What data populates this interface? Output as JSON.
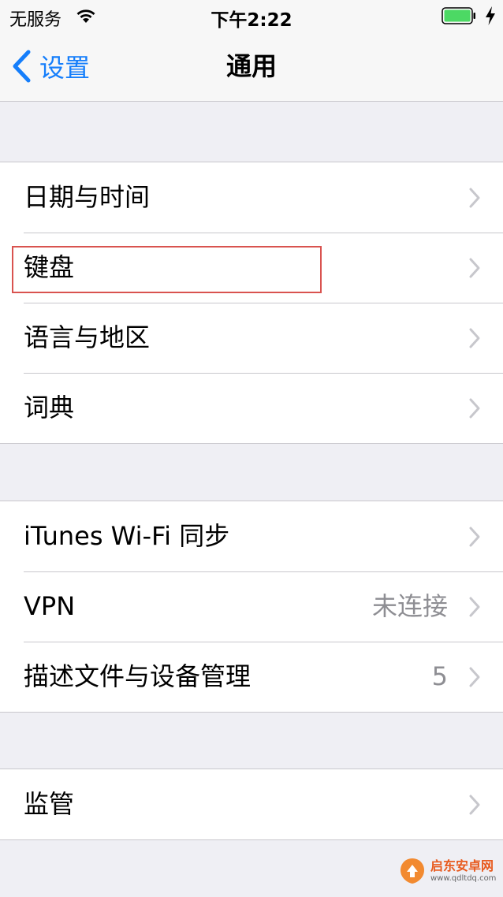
{
  "status_bar": {
    "carrier": "无服务",
    "time": "下午2:22",
    "battery_color": "#4cd964"
  },
  "nav": {
    "back_label": "设置",
    "title": "通用",
    "accent": "#157efb"
  },
  "groups": [
    {
      "rows": [
        {
          "label": "日期与时间",
          "value": ""
        },
        {
          "label": "键盘",
          "value": "",
          "highlighted": true
        },
        {
          "label": "语言与地区",
          "value": ""
        },
        {
          "label": "词典",
          "value": ""
        }
      ]
    },
    {
      "rows": [
        {
          "label": "iTunes Wi-Fi 同步",
          "value": ""
        },
        {
          "label": "VPN",
          "value": "未连接"
        },
        {
          "label": "描述文件与设备管理",
          "value": "5"
        }
      ]
    },
    {
      "rows": [
        {
          "label": "监管",
          "value": ""
        }
      ]
    }
  ],
  "watermark": {
    "name": "启东安卓网",
    "url": "www.qdltdq.com"
  }
}
